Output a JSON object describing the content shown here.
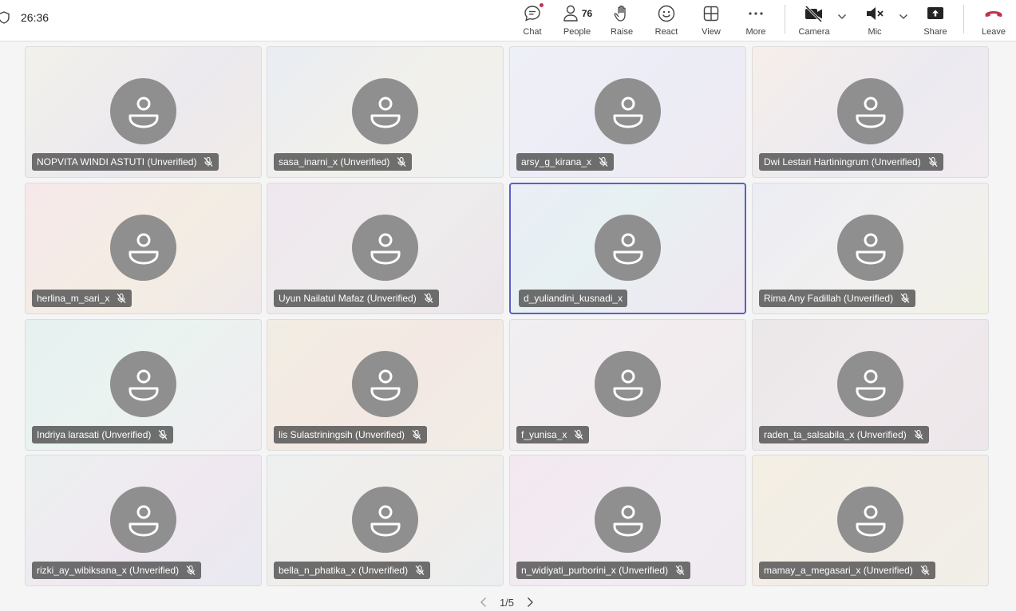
{
  "meeting": {
    "timer": "26:36"
  },
  "toolbar": {
    "chat": "Chat",
    "people": "People",
    "people_count": "76",
    "raise": "Raise",
    "react": "React",
    "view": "View",
    "more": "More",
    "camera": "Camera",
    "mic": "Mic",
    "share": "Share",
    "leave": "Leave",
    "leave_color": "#c4314b",
    "accent_color": "#5b5fc7"
  },
  "participants": [
    {
      "name": "NOPVITA WINDI ASTUTI (Unverified)",
      "muted": true
    },
    {
      "name": "sasa_inarni_x (Unverified)",
      "muted": true
    },
    {
      "name": "arsy_g_kirana_x",
      "muted": true
    },
    {
      "name": "Dwi Lestari Hartiningrum (Unverified)",
      "muted": true
    },
    {
      "name": "herlina_m_sari_x",
      "muted": true
    },
    {
      "name": "Uyun Nailatul Mafaz (Unverified)",
      "muted": true
    },
    {
      "name": "d_yuliandini_kusnadi_x",
      "muted": false,
      "active_speaker": true
    },
    {
      "name": "Rima Any Fadillah (Unverified)",
      "muted": true
    },
    {
      "name": "Indriya larasati (Unverified)",
      "muted": true
    },
    {
      "name": "lis Sulastriningsih (Unverified)",
      "muted": true
    },
    {
      "name": "f_yunisa_x",
      "muted": true
    },
    {
      "name": "raden_ta_salsabila_x (Unverified)",
      "muted": true
    },
    {
      "name": "rizki_ay_wibiksana_x (Unverified)",
      "muted": true
    },
    {
      "name": "bella_n_phatika_x (Unverified)",
      "muted": true
    },
    {
      "name": "n_widiyati_purborini_x (Unverified)",
      "muted": true
    },
    {
      "name": "mamay_a_megasari_x (Unverified)",
      "muted": true
    }
  ],
  "pagination": {
    "label": "1/5"
  }
}
